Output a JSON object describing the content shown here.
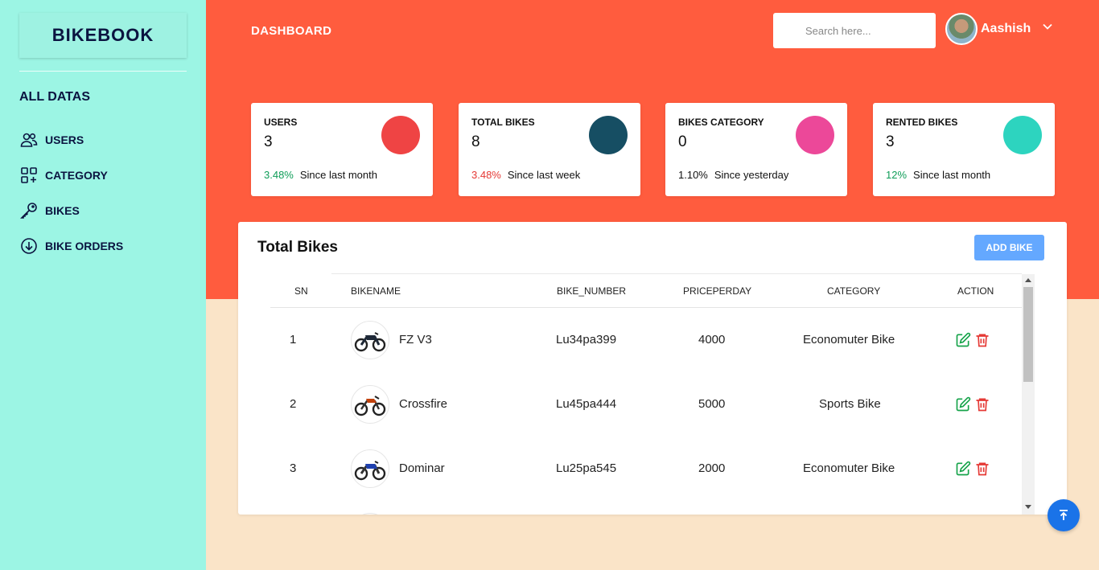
{
  "sidebar": {
    "logo": "BIKEBOOK",
    "section_title": "ALL DATAS",
    "items": [
      {
        "label": "USERS",
        "icon": "users-icon"
      },
      {
        "label": "CATEGORY",
        "icon": "category-icon"
      },
      {
        "label": "BIKES",
        "icon": "key-icon"
      },
      {
        "label": "BIKE ORDERS",
        "icon": "download-circle-icon"
      }
    ]
  },
  "header": {
    "title": "DASHBOARD",
    "search_placeholder": "Search here...",
    "user_name": "Aashish"
  },
  "stats": [
    {
      "label": "USERS",
      "value": "3",
      "pct": "3.48%",
      "pct_color": "#0f9d58",
      "note": "Since last month",
      "circle_color": "#ef4444"
    },
    {
      "label": "TOTAL BIKES",
      "value": "8",
      "pct": "3.48%",
      "pct_color": "#e53935",
      "note": "Since last week",
      "circle_color": "#164e63"
    },
    {
      "label": "BIKES CATEGORY",
      "value": "0",
      "pct": "1.10%",
      "pct_color": "#111111",
      "note": "Since yesterday",
      "circle_color": "#ec4899"
    },
    {
      "label": "RENTED BIKES",
      "value": "3",
      "pct": "12%",
      "pct_color": "#0f9d58",
      "note": "Since last month",
      "circle_color": "#2dd4bf"
    }
  ],
  "table": {
    "title": "Total Bikes",
    "add_button": "ADD BIKE",
    "columns": [
      "SN",
      "BIKENAME",
      "BIKE_NUMBER",
      "PRICEPERDAY",
      "CATEGORY",
      "ACTION"
    ],
    "rows": [
      {
        "sn": "1",
        "name": "FZ V3",
        "number": "Lu34pa399",
        "price": "4000",
        "category": "Economuter Bike",
        "bike_color": "#1f2937"
      },
      {
        "sn": "2",
        "name": "Crossfire",
        "number": "Lu45pa444",
        "price": "5000",
        "category": "Sports Bike",
        "bike_color": "#c2410c"
      },
      {
        "sn": "3",
        "name": "Dominar",
        "number": "Lu25pa545",
        "price": "2000",
        "category": "Economuter Bike",
        "bike_color": "#1e40af"
      }
    ]
  },
  "colors": {
    "sidebar_bg": "#9cf5e4",
    "header_bg": "#ff5c3e",
    "page_bg": "#fae4c8",
    "edit_green": "#16a34a",
    "delete_red": "#e53935"
  }
}
